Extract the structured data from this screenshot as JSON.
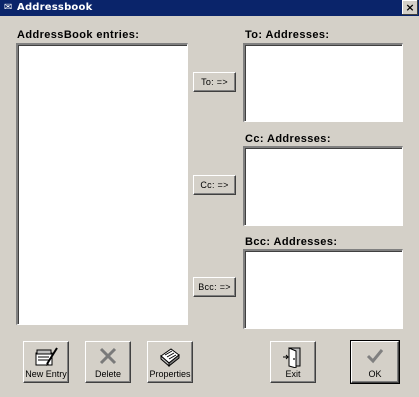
{
  "window": {
    "title": "Addressbook",
    "close_glyph": "×"
  },
  "entries": {
    "label": "AddressBook entries:",
    "items": []
  },
  "to": {
    "label": "To: Addresses:",
    "button": "To: =>"
  },
  "cc": {
    "label": "Cc: Addresses:",
    "button": "Cc: =>"
  },
  "bcc": {
    "label": "Bcc: Addresses:",
    "button": "Bcc: =>"
  },
  "toolbar": {
    "new_entry": "New Entry",
    "delete": "Delete",
    "properties": "Properties",
    "exit": "Exit",
    "ok": "OK"
  },
  "icons": {
    "new_entry": "new-entry-icon",
    "delete": "delete-x-icon",
    "properties": "properties-icon",
    "exit": "exit-door-icon",
    "ok": "checkmark-icon"
  }
}
